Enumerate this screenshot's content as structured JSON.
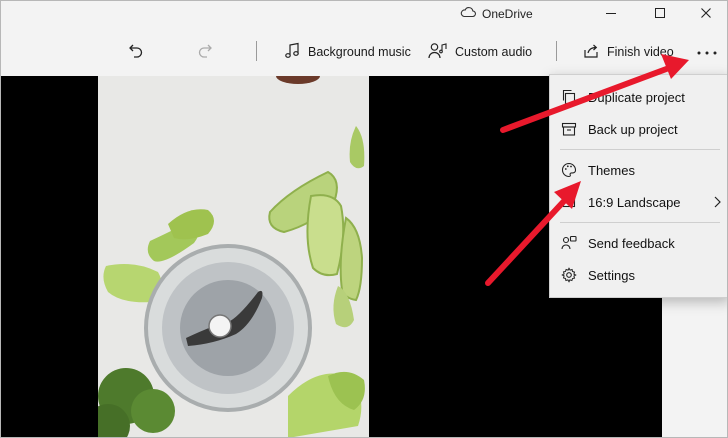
{
  "titlebar": {
    "cloud_icon": "cloud-icon",
    "app_name": "OneDrive",
    "controls": [
      "minimize-icon",
      "maximize-icon",
      "close-icon"
    ]
  },
  "toolbar": {
    "undo_icon": "undo-icon",
    "redo_icon": "redo-icon",
    "background_music": "Background music",
    "custom_audio": "Custom audio",
    "finish_video": "Finish video",
    "more_icon": "more-icon"
  },
  "menu": {
    "items": [
      {
        "label": "Duplicate project",
        "icon": "duplicate-icon"
      },
      {
        "label": "Back up project",
        "icon": "archive-icon"
      },
      {
        "label": "Themes",
        "icon": "palette-icon"
      },
      {
        "label": "16:9 Landscape",
        "icon": "aspect-ratio-icon"
      },
      {
        "label": "Send feedback",
        "icon": "feedback-icon"
      },
      {
        "label": "Settings",
        "icon": "gear-icon"
      }
    ]
  },
  "colors": {
    "arrow": "#e8192c",
    "window_bg": "#f3f3f3",
    "menu_bg": "#f0f0f0",
    "preview_bg": "#000000"
  }
}
